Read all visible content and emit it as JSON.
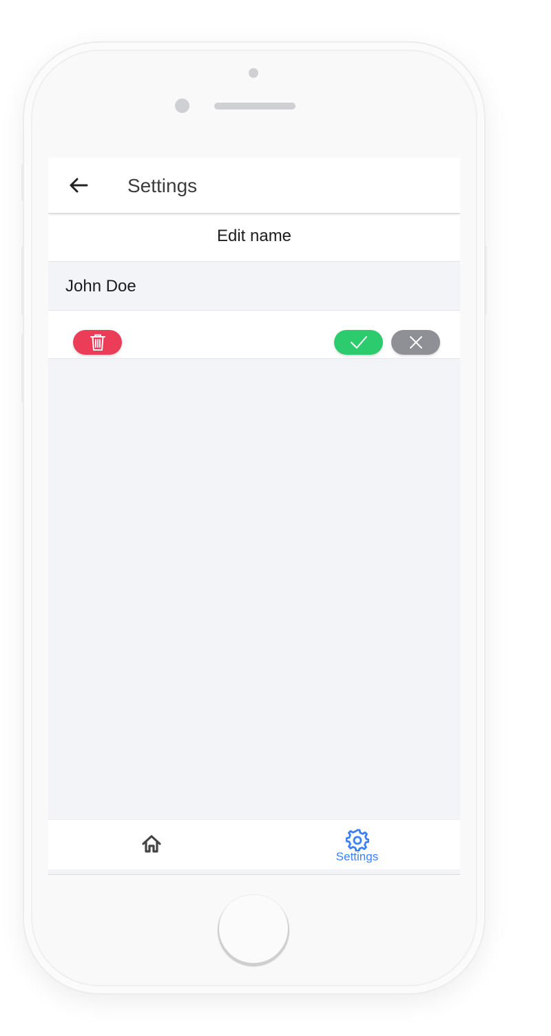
{
  "header": {
    "title": "Settings",
    "back_icon": "arrow-back-icon"
  },
  "section": {
    "title": "Edit name"
  },
  "name_field": {
    "value": "John Doe"
  },
  "actions": {
    "delete_icon": "trash-icon",
    "confirm_icon": "checkmark-icon",
    "cancel_icon": "close-icon",
    "delete_color": "#ec3d58",
    "confirm_color": "#2ccb6e",
    "cancel_color": "#8e9096"
  },
  "tab_bar": {
    "tabs": [
      {
        "icon": "home-icon",
        "label": ""
      },
      {
        "icon": "settings-gear-icon",
        "label": "Settings",
        "active": true
      }
    ],
    "active_color": "#3880ff"
  }
}
